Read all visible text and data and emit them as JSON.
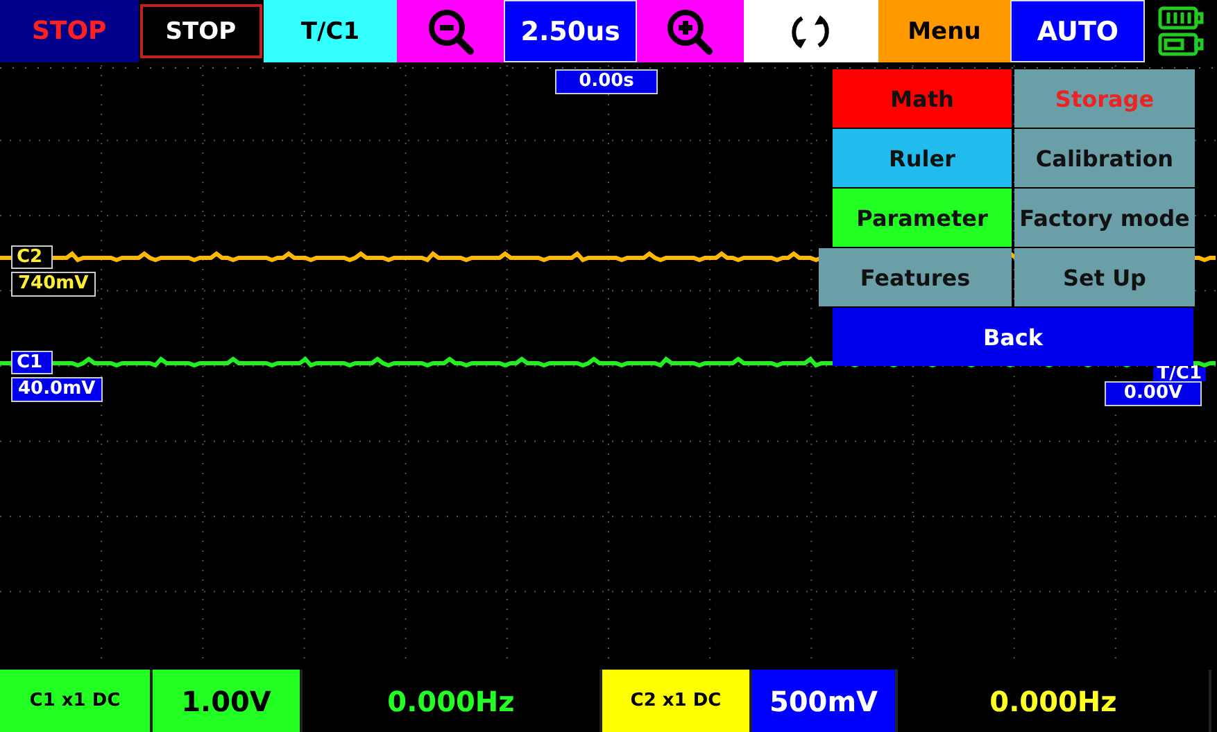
{
  "top_bar": [
    {
      "kind": "status",
      "text": "STOP"
    },
    {
      "kind": "button",
      "text": "STOP",
      "color": "#000000"
    },
    {
      "kind": "button",
      "text": "T/C1",
      "color": "#33ffff"
    },
    {
      "kind": "zoom-out",
      "color": "#ff00ff"
    },
    {
      "kind": "value",
      "text": "2.50us",
      "color": "#0000ff"
    },
    {
      "kind": "zoom-in",
      "color": "#ff00ff"
    },
    {
      "kind": "refresh",
      "color": "#ffffff"
    },
    {
      "kind": "button",
      "text": "Menu",
      "color": "#ff9900"
    },
    {
      "kind": "value",
      "text": "AUTO",
      "color": "#0000ff"
    },
    {
      "kind": "battery"
    }
  ],
  "time_marker": "0.00s",
  "channels": [
    {
      "name": "C2",
      "color": "#ffb800",
      "offset": "740mV"
    },
    {
      "name": "C1",
      "color": "#22ee22",
      "offset": "40.0mV"
    }
  ],
  "trigger": {
    "label": "T/C1",
    "level": "0.00V"
  },
  "menu": {
    "items": [
      {
        "label": "Math",
        "color": "#ff0000",
        "highlighted": false
      },
      {
        "label": "Storage",
        "color": "#6a9fa8",
        "highlighted": true
      },
      {
        "label": "Ruler",
        "color": "#22bbee",
        "highlighted": false
      },
      {
        "label": "Calibration",
        "color": "#6a9fa8",
        "highlighted": false
      },
      {
        "label": "Parameter",
        "color": "#22ff22",
        "highlighted": false
      },
      {
        "label": "Factory mode",
        "color": "#6a9fa8",
        "highlighted": false
      },
      {
        "label": "Features",
        "color": "#6a9fa8",
        "highlighted": false
      },
      {
        "label": "Set Up",
        "color": "#6a9fa8",
        "highlighted": false
      }
    ],
    "back": "Back"
  },
  "bottom_bar": [
    {
      "kind": "channel",
      "text": "C1 x1 DC",
      "color": "#22ff22"
    },
    {
      "kind": "scale",
      "text": "1.00V",
      "color": "#22ff22"
    },
    {
      "kind": "frequency",
      "text": "0.000Hz",
      "color": "#22ff22"
    },
    {
      "kind": "channel",
      "text": "C2 x1 DC",
      "color": "#ffff00"
    },
    {
      "kind": "scale",
      "text": "500mV",
      "color": "#0000ff"
    },
    {
      "kind": "frequency",
      "text": "0.000Hz",
      "color": "#ffff22"
    }
  ]
}
